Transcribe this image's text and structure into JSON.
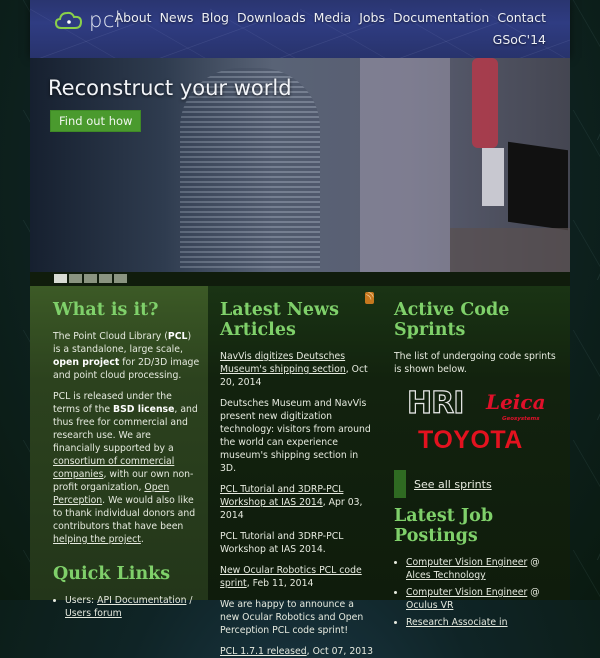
{
  "header": {
    "logo_text": "pcl",
    "nav": [
      "About",
      "News",
      "Blog",
      "Downloads",
      "Media",
      "Jobs",
      "Documentation",
      "Contact"
    ],
    "secondary_nav": "GSoC'14"
  },
  "hero": {
    "title": "Reconstruct your world",
    "button_label": "Find out how",
    "slides_count": 5,
    "active_slide": 1
  },
  "what_is_it": {
    "title": "What is it?",
    "p1_a": "The Point Cloud Library (",
    "p1_b": "PCL",
    "p1_c": ") is a standalone, large scale, ",
    "p1_d": "open project",
    "p1_e": " for 2D/3D image and point cloud processing.",
    "p2_a": "PCL is released under the terms of the ",
    "p2_b": "BSD license",
    "p2_c": ", and thus free for commercial and research use. We are financially supported by a ",
    "p2_link1": "consortium of commercial companies",
    "p2_d": ", with our own non-profit organization, ",
    "p2_link2": "Open Perception",
    "p2_e": ". We would also like to thank individual donors and contributors that have been ",
    "p2_link3": "helping the project",
    "p2_f": "."
  },
  "quick_links": {
    "title": "Quick Links",
    "items": [
      {
        "prefix": "Users: ",
        "link1": "API Documentation",
        "sep": " / ",
        "link2": "Users forum"
      }
    ]
  },
  "news": {
    "title": "Latest News Articles",
    "items": [
      {
        "link": "NavVis digitizes Deutsches Museum's shipping section",
        "date": ", Oct 20, 2014",
        "summary": "Deutsches Museum and NavVis present new digitization technology: visitors from around the world can experience museum's shipping section in 3D."
      },
      {
        "link": "PCL Tutorial and 3DRP-PCL Workshop at IAS 2014",
        "date": ", Apr 03, 2014",
        "summary": "PCL Tutorial and 3DRP-PCL Workshop at IAS 2014."
      },
      {
        "link": "New Ocular Robotics PCL code sprint",
        "date": ", Feb 11, 2014",
        "summary": "We are happy to announce a new Ocular Robotics and Open Perception PCL code sprint!"
      },
      {
        "link": "PCL 1.7.1 released",
        "date": ", Oct 07, 2013",
        "summary": ""
      }
    ]
  },
  "sprints": {
    "title": "Active Code Sprints",
    "description": "The list of undergoing code sprints is shown below.",
    "sponsors": {
      "hri": "HRI",
      "leica": "Leica",
      "leica_sub": "Geosystems",
      "toyota": "TOYOTA"
    },
    "see_all": "See all sprints"
  },
  "jobs": {
    "title": "Latest Job Postings",
    "items": [
      {
        "role": "Computer Vision Engineer",
        "at": " @ ",
        "company": "Alces Technology"
      },
      {
        "role": "Computer Vision Engineer",
        "at": " @ ",
        "company": "Oculus VR"
      },
      {
        "role": "Research Associate in",
        "at": "",
        "company": ""
      }
    ]
  }
}
